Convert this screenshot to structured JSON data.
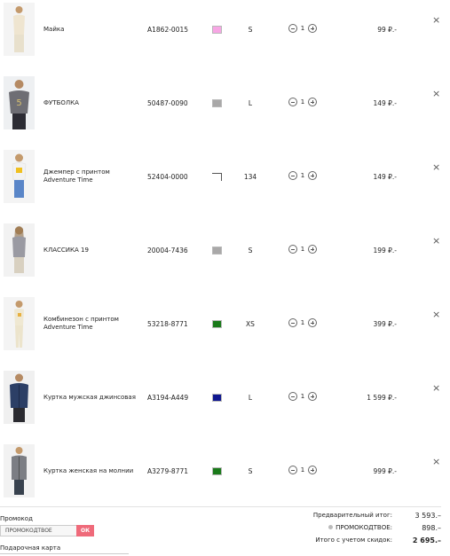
{
  "cart": {
    "items": [
      {
        "name": "Майка",
        "sku": "A1862-0015",
        "swatch": "#f7a6e4",
        "swatch_style": "fill",
        "size": "S",
        "qty": "1",
        "price": "99 ₽.-",
        "remove": "×",
        "image": "woman-tank-top-photo"
      },
      {
        "name": "ФУТБОЛКА",
        "sku": "50487-0090",
        "swatch": "#a9a8a8",
        "swatch_style": "fill",
        "size": "L",
        "qty": "1",
        "price": "149 ₽.-",
        "remove": "×",
        "image": "man-tshirt-photo"
      },
      {
        "name": "Джемпер с принтом Adventure Time",
        "sku": "52404-0000",
        "swatch": "#ffffff",
        "swatch_style": "outline",
        "size": "134",
        "qty": "1",
        "price": "149 ₽.-",
        "remove": "×",
        "image": "kid-jumper-photo"
      },
      {
        "name": "КЛАССИКА 19",
        "sku": "20004-7436",
        "swatch": "#a9a8a8",
        "swatch_style": "fill",
        "size": "S",
        "qty": "1",
        "price": "199 ₽.-",
        "remove": "×",
        "image": "woman-grey-top-photo"
      },
      {
        "name": "Комбинезон с принтом Adventure Time",
        "sku": "53218-8771",
        "swatch": "#1a7a1a",
        "swatch_style": "fill",
        "size": "XS",
        "qty": "1",
        "price": "399 ₽.-",
        "remove": "×",
        "image": "woman-jumpsuit-photo"
      },
      {
        "name": "Куртка мужская джинсовая",
        "sku": "A3194-A449",
        "swatch": "#101890",
        "swatch_style": "fill",
        "size": "L",
        "qty": "1",
        "price": "1 599 ₽.-",
        "remove": "×",
        "image": "man-denim-jacket-photo"
      },
      {
        "name": "Куртка женская на молнии",
        "sku": "A3279-8771",
        "swatch": "#1a7a1a",
        "swatch_style": "fill",
        "size": "S",
        "qty": "1",
        "price": "999 ₽.-",
        "remove": "×",
        "image": "woman-zip-jacket-photo"
      }
    ]
  },
  "promo": {
    "label": "Промокод",
    "value": "ПРОМОКОДТВОЕ",
    "ok_label": "ОК"
  },
  "gift": {
    "label": "Подарочная карта"
  },
  "summary": {
    "subtotal_label": "Предварительный итог:",
    "subtotal_value": "3 593.–",
    "promo_label": "ПРОМОКОДТВОЕ:",
    "promo_value": "898.–",
    "total_label": "Итого с учетом скидок:",
    "total_value": "2 695.–"
  },
  "colors": {
    "accent": "#ef6a7a",
    "text": "#222222",
    "divider": "#e2e2e2"
  }
}
